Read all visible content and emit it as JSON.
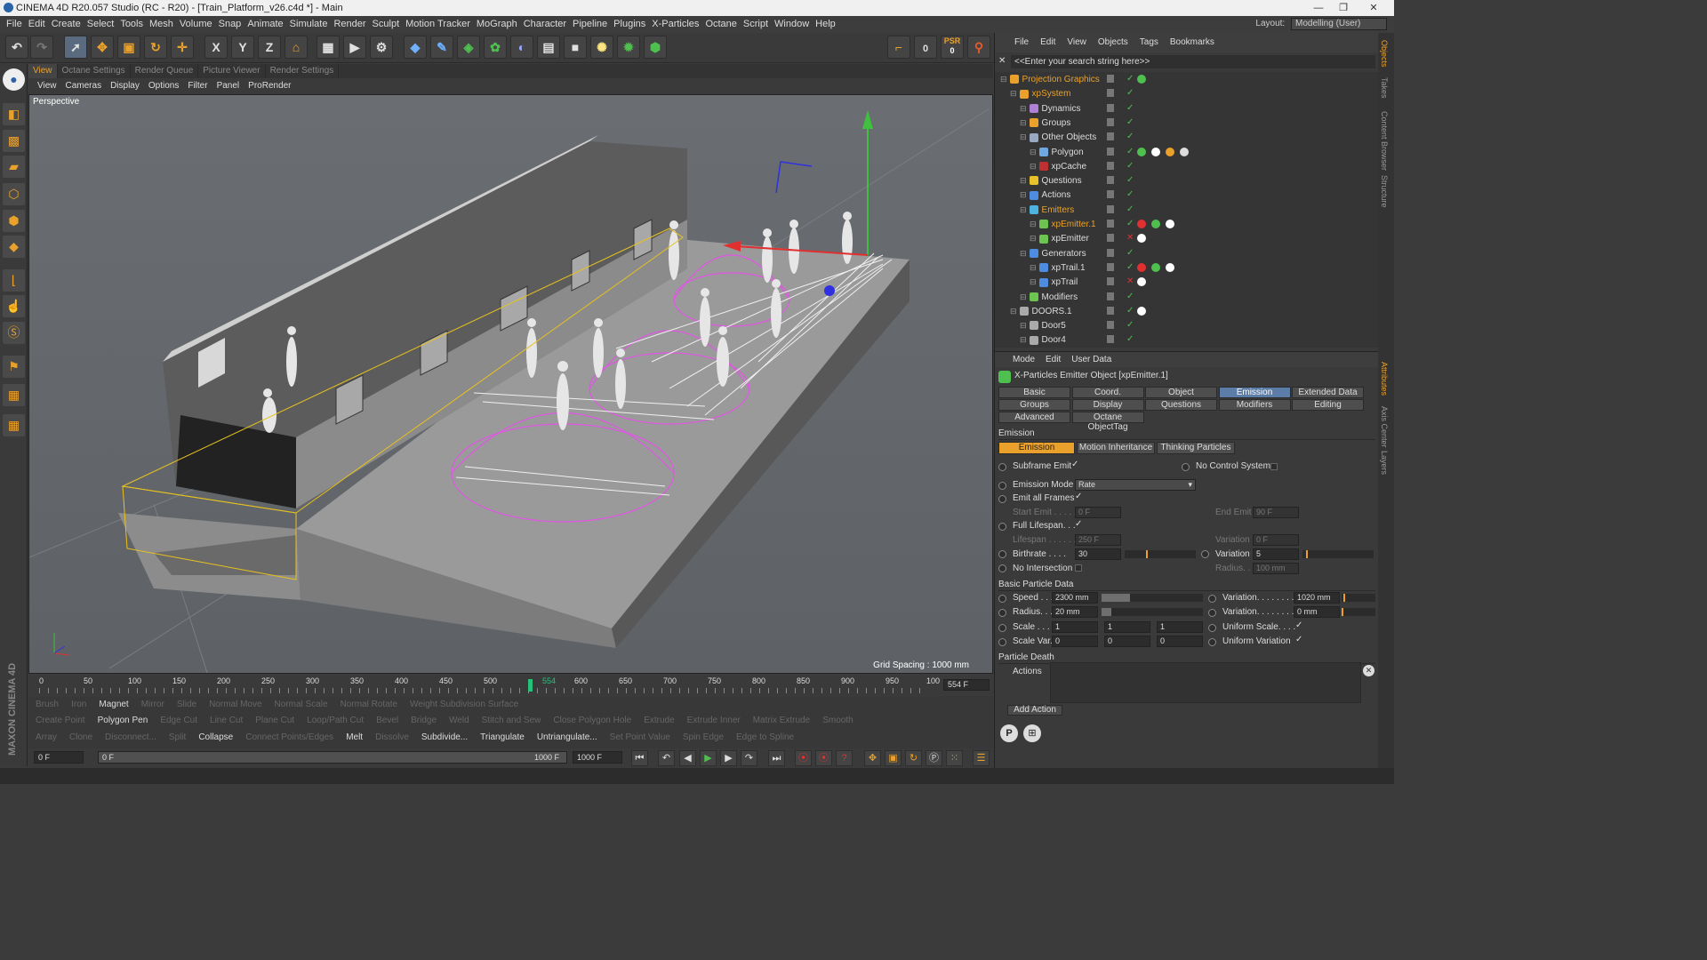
{
  "window": {
    "title": "CINEMA 4D R20.057 Studio (RC - R20) - [Train_Platform_v26.c4d *] - Main",
    "controls": [
      "—",
      "❐",
      "✕"
    ]
  },
  "menubar": [
    "File",
    "Edit",
    "Create",
    "Select",
    "Tools",
    "Mesh",
    "Volume",
    "Snap",
    "Animate",
    "Simulate",
    "Render",
    "Sculpt",
    "Motion Tracker",
    "MoGraph",
    "Character",
    "Pipeline",
    "Plugins",
    "X-Particles",
    "Octane",
    "Script",
    "Window",
    "Help"
  ],
  "layout": {
    "label": "Layout:",
    "value": "Modelling (User)"
  },
  "toolbar": {
    "axis": [
      "X",
      "Y",
      "Z"
    ],
    "psr_label": "PSR",
    "psr_value": "0",
    "frame_counter": "0"
  },
  "viewport": {
    "tabs": [
      "View",
      "Octane Settings",
      "Render Queue",
      "Picture Viewer",
      "Render Settings"
    ],
    "menu": [
      "View",
      "Cameras",
      "Display",
      "Options",
      "Filter",
      "Panel",
      "ProRender"
    ],
    "camera": "Perspective",
    "grid_spacing": "Grid Spacing : 1000 mm"
  },
  "timeline": {
    "ticks": [
      "0",
      "50",
      "100",
      "150",
      "200",
      "250",
      "300",
      "350",
      "400",
      "450",
      "500",
      "554",
      "600",
      "650",
      "700",
      "750",
      "800",
      "850",
      "900",
      "950",
      "100"
    ],
    "current_frame": "554 F",
    "marker_frame": 554
  },
  "tools": {
    "row1": [
      {
        "t": "Brush",
        "on": false
      },
      {
        "t": "Iron",
        "on": false
      },
      {
        "t": "Magnet",
        "on": true
      },
      {
        "t": "Mirror",
        "on": false
      },
      {
        "t": "Slide",
        "on": false
      },
      {
        "t": "Normal Move",
        "on": false
      },
      {
        "t": "Normal Scale",
        "on": false
      },
      {
        "t": "Normal Rotate",
        "on": false
      },
      {
        "t": "Weight Subdivision Surface",
        "on": false
      }
    ],
    "row2": [
      {
        "t": "Create Point",
        "on": false
      },
      {
        "t": "Polygon Pen",
        "on": true
      },
      {
        "t": "Edge Cut",
        "on": false
      },
      {
        "t": "Line Cut",
        "on": false
      },
      {
        "t": "Plane Cut",
        "on": false
      },
      {
        "t": "Loop/Path Cut",
        "on": false
      },
      {
        "t": "Bevel",
        "on": false
      },
      {
        "t": "Bridge",
        "on": false
      },
      {
        "t": "Weld",
        "on": false
      },
      {
        "t": "Stitch and Sew",
        "on": false
      },
      {
        "t": "Close Polygon Hole",
        "on": false
      },
      {
        "t": "Extrude",
        "on": false
      },
      {
        "t": "Extrude Inner",
        "on": false
      },
      {
        "t": "Matrix Extrude",
        "on": false
      },
      {
        "t": "Smooth",
        "on": false
      }
    ],
    "row3": [
      {
        "t": "Array",
        "on": false
      },
      {
        "t": "Clone",
        "on": false
      },
      {
        "t": "Disconnect...",
        "on": false
      },
      {
        "t": "Split",
        "on": false
      },
      {
        "t": "Collapse",
        "on": true
      },
      {
        "t": "Connect Points/Edges",
        "on": false
      },
      {
        "t": "Melt",
        "on": true
      },
      {
        "t": "Dissolve",
        "on": false
      },
      {
        "t": "Subdivide...",
        "on": true
      },
      {
        "t": "Triangulate",
        "on": true
      },
      {
        "t": "Untriangulate...",
        "on": true
      },
      {
        "t": "Set Point Value",
        "on": false
      },
      {
        "t": "Spin Edge",
        "on": false
      },
      {
        "t": "Edge to Spline",
        "on": false
      }
    ]
  },
  "playback": {
    "start": "0 F",
    "scrub_start": "0 F",
    "scrub_end": "1000 F",
    "end": "1000 F"
  },
  "object_manager": {
    "menu": [
      "File",
      "Edit",
      "View",
      "Objects",
      "Tags",
      "Bookmarks"
    ],
    "search_placeholder": "<<Enter your search string here>>",
    "objects": [
      {
        "name": "Projection Graphics",
        "indent": 0,
        "hl": true,
        "color": "#e9a12b"
      },
      {
        "name": "xpSystem",
        "indent": 1,
        "hl": true,
        "color": "#e9a12b"
      },
      {
        "name": "Dynamics",
        "indent": 2,
        "hl": false,
        "color": "#b07fd6"
      },
      {
        "name": "Groups",
        "indent": 2,
        "hl": false,
        "color": "#e9a12b"
      },
      {
        "name": "Other Objects",
        "indent": 2,
        "hl": false,
        "color": "#9aa9c2"
      },
      {
        "name": "Polygon",
        "indent": 3,
        "hl": false,
        "color": "#6fa7e0"
      },
      {
        "name": "xpCache",
        "indent": 3,
        "hl": false,
        "color": "#c03030"
      },
      {
        "name": "Questions",
        "indent": 2,
        "hl": false,
        "color": "#e9c22b"
      },
      {
        "name": "Actions",
        "indent": 2,
        "hl": false,
        "color": "#4d8ce0"
      },
      {
        "name": "Emitters",
        "indent": 2,
        "hl": true,
        "color": "#4db3e0"
      },
      {
        "name": "xpEmitter.1",
        "indent": 3,
        "hl": true,
        "color": "#6cc34f"
      },
      {
        "name": "xpEmitter",
        "indent": 3,
        "hl": false,
        "color": "#6cc34f"
      },
      {
        "name": "Generators",
        "indent": 2,
        "hl": false,
        "color": "#4d8ce0"
      },
      {
        "name": "xpTrail.1",
        "indent": 3,
        "hl": false,
        "color": "#4d8ce0"
      },
      {
        "name": "xpTrail",
        "indent": 3,
        "hl": false,
        "color": "#4d8ce0"
      },
      {
        "name": "Modifiers",
        "indent": 2,
        "hl": false,
        "color": "#6cc34f"
      },
      {
        "name": "DOORS.1",
        "indent": 1,
        "hl": false,
        "color": "#aaaaaa"
      },
      {
        "name": "Door5",
        "indent": 2,
        "hl": false,
        "color": "#aaaaaa"
      },
      {
        "name": "Door4",
        "indent": 2,
        "hl": false,
        "color": "#aaaaaa"
      }
    ]
  },
  "attributes": {
    "menu": [
      "Mode",
      "Edit",
      "User Data"
    ],
    "title": "X-Particles Emitter Object [xpEmitter.1]",
    "tabs_row1": [
      "Basic",
      "Coord.",
      "Object",
      "Emission",
      "Extended Data"
    ],
    "tabs_row2": [
      "Groups",
      "Display",
      "Questions",
      "Modifiers",
      "Editing"
    ],
    "tabs_row3": [
      "Advanced",
      "Octane ObjectTag"
    ],
    "active_tab": "Emission",
    "section_emission": "Emission",
    "emission_tabs": [
      "Emission",
      "Motion Inheritance",
      "Thinking Particles"
    ],
    "subframe_emit": "Subframe Emit",
    "no_control_system": "No Control System",
    "emission_mode_label": "Emission Mode",
    "emission_mode_value": "Rate",
    "emit_all_frames": "Emit all Frames",
    "start_emit_label": "Start Emit . . . . .",
    "start_emit_value": "0 F",
    "end_emit_label": "End Emit",
    "end_emit_value": "90 F",
    "full_lifespan": "Full Lifespan. . .",
    "lifespan_label": "Lifespan . . . . . .",
    "lifespan_value": "250 F",
    "lifespan_variation_label": "Variation",
    "lifespan_variation_value": "0 F",
    "birthrate_label": "Birthrate . . . .",
    "birthrate_value": "30",
    "birthrate_variation_label": "Variation",
    "birthrate_variation_value": "5",
    "no_intersection": "No Intersection",
    "radius_label": "Radius. .",
    "radius_value": "100 mm",
    "section_basic": "Basic Particle Data",
    "speed_label": "Speed . . .",
    "speed_value": "2300 mm",
    "speed_var_label": "Variation. . . . . . . .",
    "speed_var_value": "1020 mm",
    "pradius_label": "Radius. . .",
    "pradius_value": "20 mm",
    "pradius_var_label": "Variation. . . . . . . .",
    "pradius_var_value": "0 mm",
    "scale_label": "Scale . . . .",
    "scale_values": [
      "1",
      "1",
      "1"
    ],
    "uniform_scale": "Uniform Scale. . . .",
    "scale_var_label": "Scale Var.",
    "scale_var_values": [
      "0",
      "0",
      "0"
    ],
    "uniform_variation": "Uniform Variation",
    "section_death": "Particle Death",
    "actions_label": "Actions",
    "add_action": "Add Action",
    "levels": {
      "birthrate": 0.3,
      "birthrate_var": 0.05,
      "speed": 0.28,
      "speed_var": 0.06,
      "pradius": 0.1
    }
  },
  "side_tabs": [
    "Objects",
    "Takes",
    "Content Browser",
    "Structure",
    "Attributes",
    "Axis Center",
    "Layers"
  ],
  "maxon_logo": "MAXON CINEMA 4D"
}
